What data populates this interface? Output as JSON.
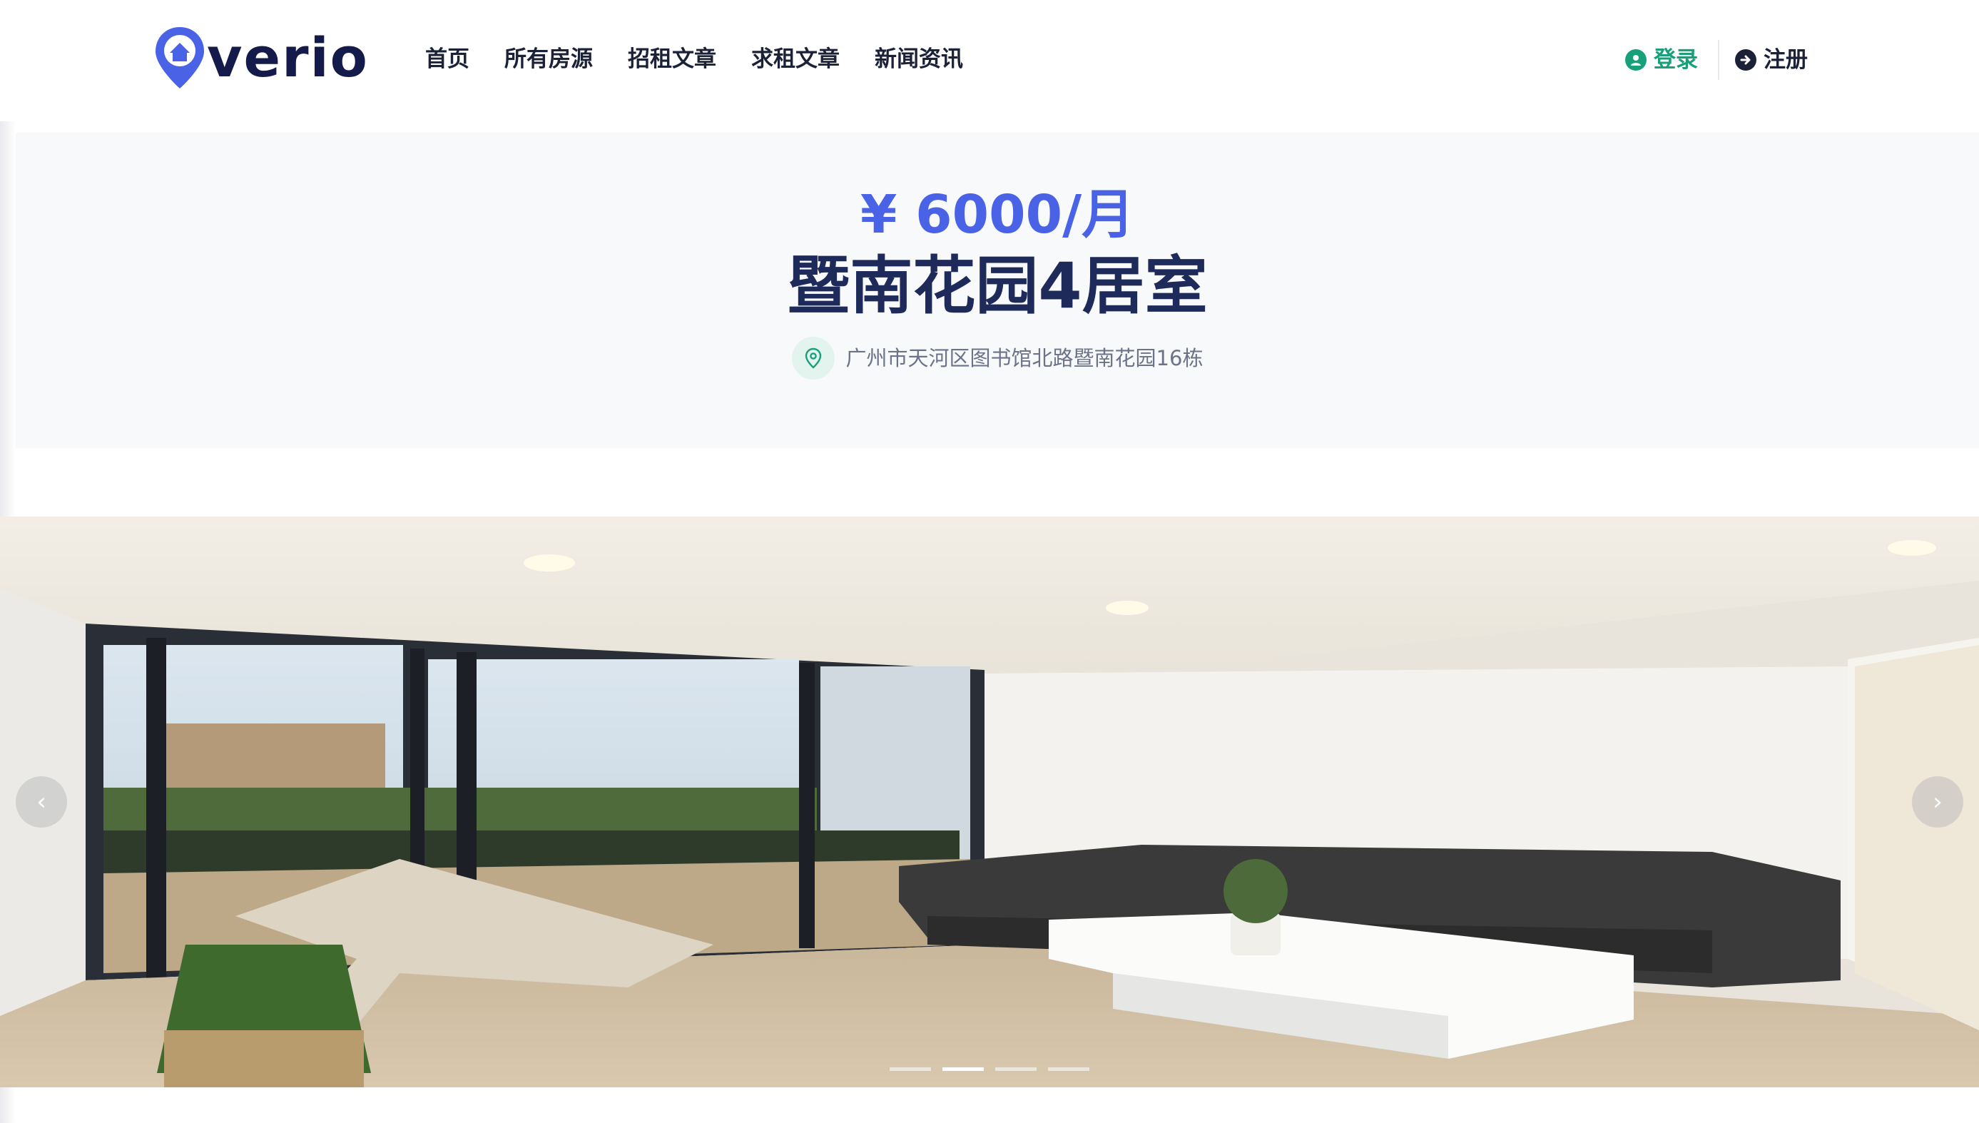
{
  "brand": {
    "name": "verio",
    "accent": "#4a63e6",
    "dark": "#141a4a",
    "green": "#18a07a"
  },
  "nav": {
    "items": [
      "首页",
      "所有房源",
      "招租文章",
      "求租文章",
      "新闻资讯"
    ]
  },
  "auth": {
    "login_label": "登录",
    "login_icon": "user-circle-icon",
    "register_label": "注册",
    "register_icon": "arrow-circle-right-icon"
  },
  "listing": {
    "price": "¥ 6000/月",
    "title": "暨南花园4居室",
    "address": "广州市天河区图书馆北路暨南花园16栋",
    "address_icon": "map-pin-icon"
  },
  "gallery": {
    "prev_icon": "chevron-left-icon",
    "next_icon": "chevron-right-icon",
    "prev_glyph": "‹",
    "next_glyph": "›",
    "slide_count": 4,
    "active_slide": 2
  }
}
